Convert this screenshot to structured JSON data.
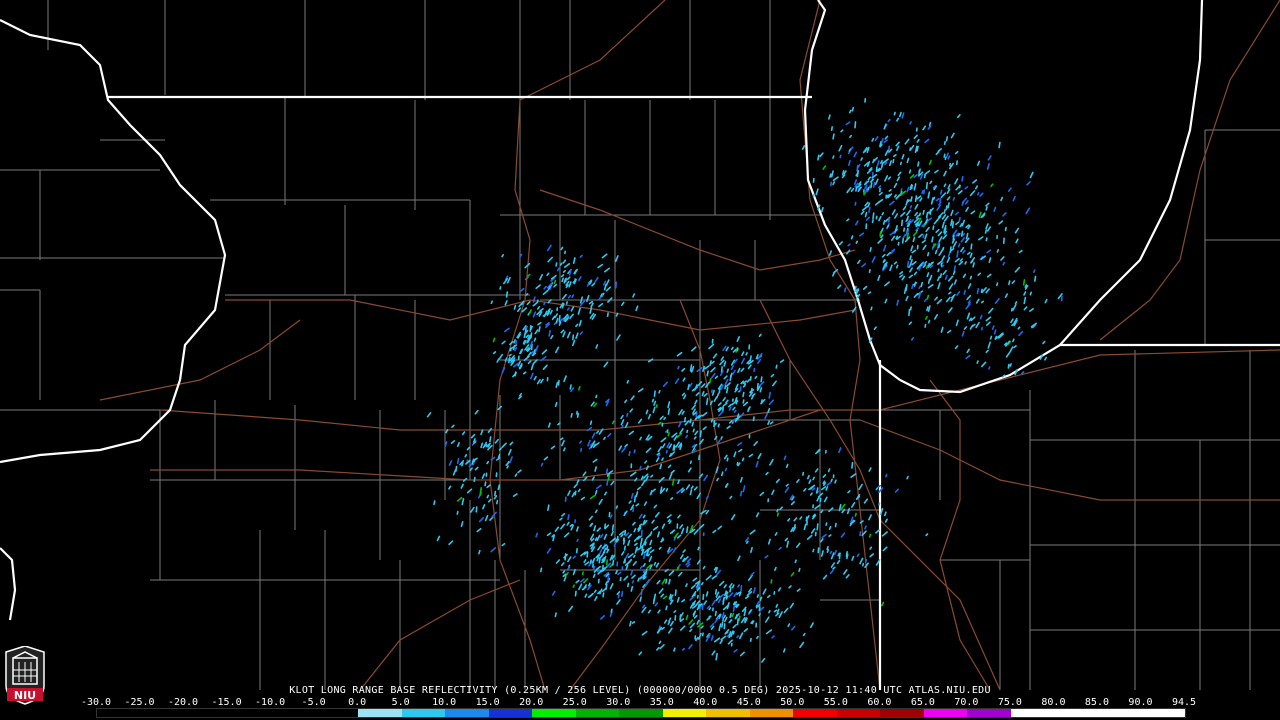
{
  "product": {
    "caption": "KLOT LONG RANGE BASE REFLECTIVITY (0.25KM / 256 LEVEL) (000000/0000 0.5 DEG) 2025-10-12 11:40 UTC  ATLAS.NIU.EDU"
  },
  "scale": {
    "labels": [
      "-30.0",
      "-25.0",
      "-20.0",
      "-15.0",
      "-10.0",
      "-5.0",
      "0.0",
      "5.0",
      "10.0",
      "15.0",
      "20.0",
      "25.0",
      "30.0",
      "35.0",
      "40.0",
      "45.0",
      "50.0",
      "55.0",
      "60.0",
      "65.0",
      "70.0",
      "75.0",
      "80.0",
      "85.0",
      "90.0",
      "94.5"
    ],
    "colors": [
      "#000000",
      "#000000",
      "#000000",
      "#000000",
      "#000000",
      "#000000",
      "#9ae4f4",
      "#2ccaf0",
      "#1b8af0",
      "#1432d8",
      "#00f000",
      "#00b400",
      "#009a00",
      "#f0f000",
      "#f0c000",
      "#f09000",
      "#f00000",
      "#c80000",
      "#a00000",
      "#f000f0",
      "#a000d0",
      "#ffffff",
      "#ffffff",
      "#ffffff",
      "#ffffff"
    ]
  },
  "logo": {
    "text": "NIU",
    "color": "#c8102e"
  },
  "map_colors": {
    "state_border": "#ffffff",
    "county_line": "#7a7a7a",
    "highway": "#8b4a2e",
    "echo_light": "#2ccaf0",
    "echo_mid": "#1b6af0",
    "echo_green": "#00c000"
  }
}
